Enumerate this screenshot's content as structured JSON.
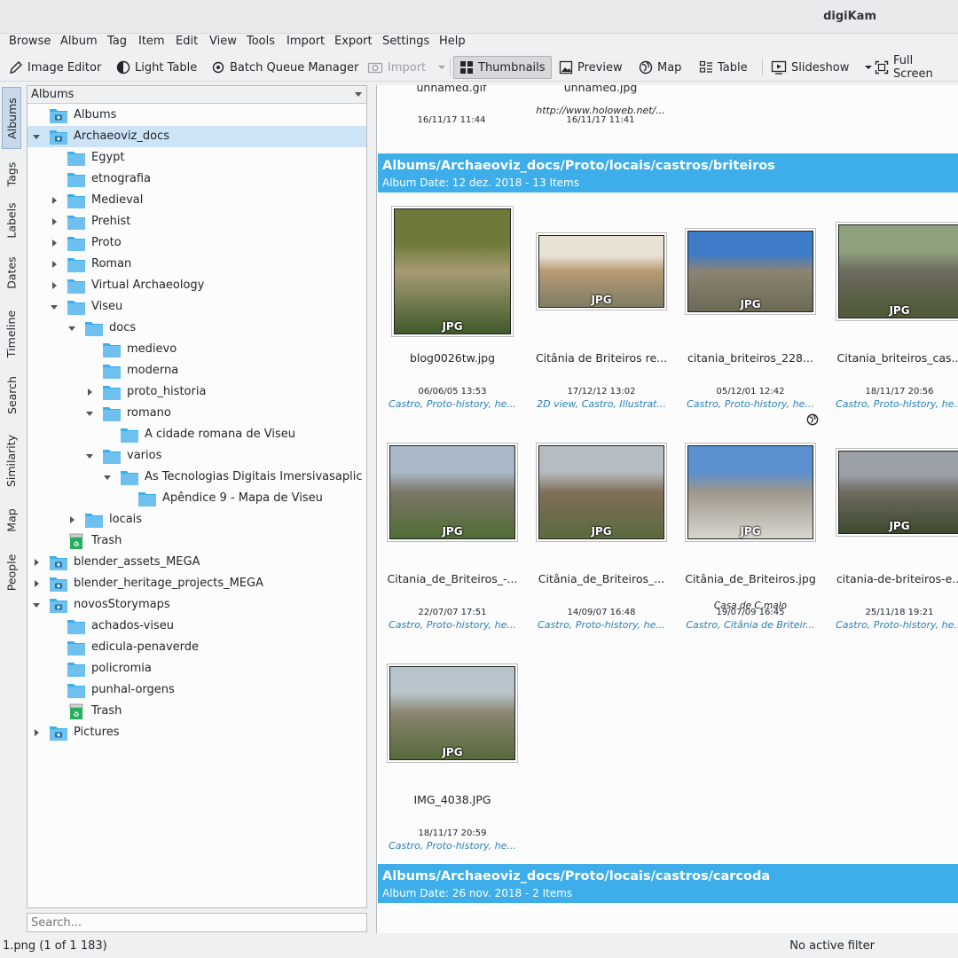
{
  "window": {
    "title": "digiKam"
  },
  "menu": [
    "Browse",
    "Album",
    "Tag",
    "Item",
    "Edit",
    "View",
    "Tools",
    "Import",
    "Export",
    "Settings",
    "Help"
  ],
  "toolbar": {
    "image_editor": "Image Editor",
    "light_table": "Light Table",
    "batch_queue": "Batch Queue Manager",
    "import": "Import",
    "thumbnails": "Thumbnails",
    "preview": "Preview",
    "map": "Map",
    "table": "Table",
    "slideshow": "Slideshow",
    "full_screen": "Full Screen"
  },
  "sidetabs": [
    "Albums",
    "Tags",
    "Labels",
    "Dates",
    "Timeline",
    "Search",
    "Similarity",
    "Map",
    "People"
  ],
  "left": {
    "combo": "Albums",
    "search_placeholder": "Search...",
    "tree": [
      {
        "label": "Albums",
        "level": 0,
        "icon": "album-root",
        "exp": ""
      },
      {
        "label": "Archaeoviz_docs",
        "level": 0,
        "icon": "album-cam",
        "exp": "open",
        "selected": true
      },
      {
        "label": "Egypt",
        "level": 1,
        "icon": "folder",
        "exp": ""
      },
      {
        "label": "etnografia",
        "level": 1,
        "icon": "folder",
        "exp": ""
      },
      {
        "label": "Medieval",
        "level": 1,
        "icon": "folder",
        "exp": "closed"
      },
      {
        "label": "Prehist",
        "level": 1,
        "icon": "folder",
        "exp": "closed"
      },
      {
        "label": "Proto",
        "level": 1,
        "icon": "folder",
        "exp": "closed"
      },
      {
        "label": "Roman",
        "level": 1,
        "icon": "folder",
        "exp": "closed"
      },
      {
        "label": "Virtual Archaeology",
        "level": 1,
        "icon": "folder",
        "exp": "closed"
      },
      {
        "label": "Viseu",
        "level": 1,
        "icon": "folder",
        "exp": "open"
      },
      {
        "label": "docs",
        "level": 2,
        "icon": "folder",
        "exp": "open"
      },
      {
        "label": "medievo",
        "level": 3,
        "icon": "folder",
        "exp": ""
      },
      {
        "label": "moderna",
        "level": 3,
        "icon": "folder",
        "exp": ""
      },
      {
        "label": "proto_historia",
        "level": 3,
        "icon": "folder",
        "exp": "closed"
      },
      {
        "label": "romano",
        "level": 3,
        "icon": "folder",
        "exp": "open"
      },
      {
        "label": "A cidade romana de Viseu",
        "level": 4,
        "icon": "folder",
        "exp": ""
      },
      {
        "label": "varios",
        "level": 3,
        "icon": "folder",
        "exp": "open"
      },
      {
        "label": "As Tecnologias Digitais Imersivasaplica...",
        "level": 4,
        "icon": "folder",
        "exp": "open"
      },
      {
        "label": "Apêndice 9 - Mapa de Viseu",
        "level": 5,
        "icon": "folder",
        "exp": ""
      },
      {
        "label": "locais",
        "level": 2,
        "icon": "folder",
        "exp": "closed"
      },
      {
        "label": "Trash",
        "level": 1,
        "icon": "trash",
        "exp": ""
      },
      {
        "label": "blender_assets_MEGA",
        "level": 0,
        "icon": "album-cam",
        "exp": "closed"
      },
      {
        "label": "blender_heritage_projects_MEGA",
        "level": 0,
        "icon": "album-cam",
        "exp": "closed"
      },
      {
        "label": "novosStorymaps",
        "level": 0,
        "icon": "album-cam",
        "exp": "open"
      },
      {
        "label": "achados-viseu",
        "level": 1,
        "icon": "folder",
        "exp": ""
      },
      {
        "label": "edicula-penaverde",
        "level": 1,
        "icon": "folder",
        "exp": ""
      },
      {
        "label": "policromia",
        "level": 1,
        "icon": "folder",
        "exp": ""
      },
      {
        "label": "punhal-orgens",
        "level": 1,
        "icon": "folder",
        "exp": ""
      },
      {
        "label": "Trash",
        "level": 1,
        "icon": "trash",
        "exp": ""
      },
      {
        "label": "Pictures",
        "level": 0,
        "icon": "album-cam",
        "exp": "closed"
      }
    ]
  },
  "top_partial": [
    {
      "name": "unnamed.gif",
      "caption": "",
      "date": "16/11/17 11:44"
    },
    {
      "name": "unnamed.jpg",
      "caption": "http://www.holoweb.net/...",
      "date": "16/11/17 11:41"
    }
  ],
  "albums": [
    {
      "path": "Albums/Archaeoviz_docs/Proto/locais/castros/briteiros",
      "sub": "Album Date: 12 dez. 2018 - 13 Items"
    },
    {
      "path": "Albums/Archaeoviz_docs/Proto/locais/castros/carcoda",
      "sub": "Album Date: 26 nov. 2018 - 2 Items"
    }
  ],
  "items": [
    {
      "name": "blog0026tw.jpg",
      "caption": "",
      "date": "06/06/05 13:53",
      "tags": "Castro, Proto-history, he...",
      "badge": "JPG",
      "geo": false,
      "colors": [
        "#6f7a3a",
        "#a79b73",
        "#3f5a2a"
      ]
    },
    {
      "name": "Citânia de Briteiros re...",
      "caption": "",
      "date": "17/12/12 13:02",
      "tags": "2D view, Castro, Illustrat...",
      "badge": "JPG",
      "geo": false,
      "colors": [
        "#e8e2d4",
        "#b69a72",
        "#7f7d66"
      ]
    },
    {
      "name": "citania_briteiros_228...",
      "caption": "",
      "date": "05/12/01 12:42",
      "tags": "Castro, Proto-history, he...",
      "badge": "JPG",
      "geo": false,
      "colors": [
        "#3d7cc9",
        "#8c8373",
        "#6b6a55"
      ]
    },
    {
      "name": "Citania_briteiros_cas...",
      "caption": "",
      "date": "18/11/17 20:56",
      "tags": "Castro, Proto-history, he...",
      "badge": "JPG",
      "geo": false,
      "colors": [
        "#8ea07c",
        "#6d6a5f",
        "#4d5a35"
      ]
    },
    {
      "name": "Citania_de_Briteiros_-...",
      "caption": "",
      "date": "22/07/07 17:51",
      "tags": "Castro, Proto-history, he...",
      "badge": "JPG",
      "geo": false,
      "colors": [
        "#a9b8c8",
        "#7c7669",
        "#4f6d34"
      ]
    },
    {
      "name": "Citânia_de_Briteiros_...",
      "caption": "",
      "date": "14/09/07 16:48",
      "tags": "Castro, Proto-history, he...",
      "badge": "JPG",
      "geo": false,
      "colors": [
        "#b5bcc2",
        "#806e5a",
        "#5b6a3c"
      ]
    },
    {
      "name": "Citânia_de_Briteiros.jpg",
      "caption": "Casa de C,malo",
      "date": "19/07/09 16:45",
      "tags": "Castro, Citânia de Briteir...",
      "badge": "JPG",
      "geo": true,
      "colors": [
        "#5c8fd0",
        "#9e988b",
        "#d9d6cf"
      ]
    },
    {
      "name": "citania-de-briteiros-e...",
      "caption": "",
      "date": "25/11/18 19:21",
      "tags": "Castro, Proto-history, he...",
      "badge": "JPG",
      "geo": false,
      "colors": [
        "#9aa0a6",
        "#6e6a60",
        "#3d4a2e"
      ]
    },
    {
      "name": "IMG_4038.JPG",
      "caption": "",
      "date": "18/11/17 20:59",
      "tags": "Castro, Proto-history, he...",
      "badge": "JPG",
      "geo": false,
      "colors": [
        "#b8c4cc",
        "#8a8470",
        "#576b3c"
      ]
    }
  ],
  "status": {
    "left": "1.png (1 of 1 183)",
    "right": "No active filter"
  }
}
